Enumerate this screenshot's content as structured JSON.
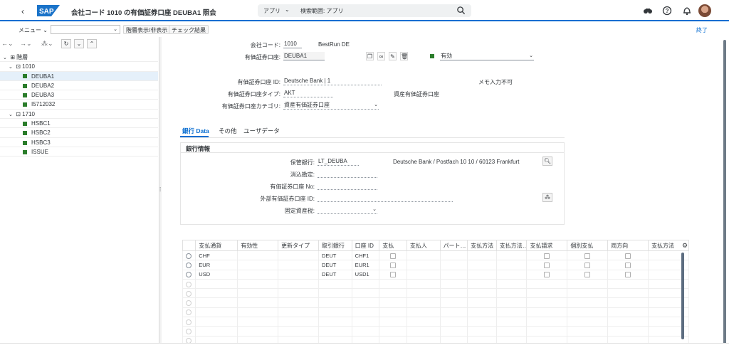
{
  "shell": {
    "title": "会社コード 1010 の有価証券口座 DEUBA1 照会",
    "search_scope": "アプリ",
    "search_text": "検索範囲: アプリ",
    "logo_text": "SAP"
  },
  "toolbar": {
    "menu_label": "メニュー",
    "hierarchy_toggle_label": "階層表示/非表示",
    "check_results_label": "チェック結果",
    "exit_label": "終了"
  },
  "tree": {
    "root_label": "階層",
    "groups": [
      {
        "label": "1010",
        "items": [
          "DEUBA1",
          "DEUBA2",
          "DEUBA3",
          "I5712032"
        ]
      },
      {
        "label": "1710",
        "items": [
          "HSBC1",
          "HSBC2",
          "HSBC3",
          "ISSUE"
        ]
      }
    ],
    "selected": "DEUBA1",
    "status_color": "#2b7d2b"
  },
  "header": {
    "company_code_label": "会社コード:",
    "company_code_value": "1010",
    "company_name": "BestRun DE",
    "account_label": "有価証券口座:",
    "account_value": "DEUBA1",
    "status_value": "有効",
    "account_id_label": "有価証券口座 ID:",
    "account_id_value": "Deutsche Bank | 1",
    "memo_text": "メモ入力不可",
    "account_type_label": "有価証券口座タイプ:",
    "account_type_value": "AKT",
    "account_type_desc": "資産有価証券口座",
    "category_label": "有価証券口座カテゴリ:",
    "category_value": "資産有価証券口座"
  },
  "tabs": [
    "銀行 Data",
    "その他",
    "ユーザデータ"
  ],
  "active_tab": "銀行 Data",
  "bank_info": {
    "section_title": "銀行情報",
    "custodian_label": "保管銀行:",
    "custodian_value": "LT_DEUBA",
    "custodian_desc": "Deutsche Bank / Postfach 10 10 / 60123 Frankfurt",
    "clearing_label": "消込勘定:",
    "account_no_label": "有価証券口座 No:",
    "external_id_label": "外部有価証券口座 ID:",
    "fixed_asset_label": "固定資産税:"
  },
  "table": {
    "columns": [
      "支払通貨",
      "有効性",
      "更新タイプ",
      "取引銀行",
      "口座 ID",
      "支払",
      "支払人",
      "パート…",
      "支払方法",
      "支払方法…",
      "支払請求",
      "個別支払",
      "両方向",
      "支払方法"
    ],
    "rows": [
      {
        "currency": "CHF",
        "bank": "DEUT",
        "account_id": "CHF1"
      },
      {
        "currency": "EUR",
        "bank": "DEUT",
        "account_id": "EUR1"
      },
      {
        "currency": "USD",
        "bank": "DEUT",
        "account_id": "USD1"
      }
    ],
    "empty_rows": 7
  }
}
